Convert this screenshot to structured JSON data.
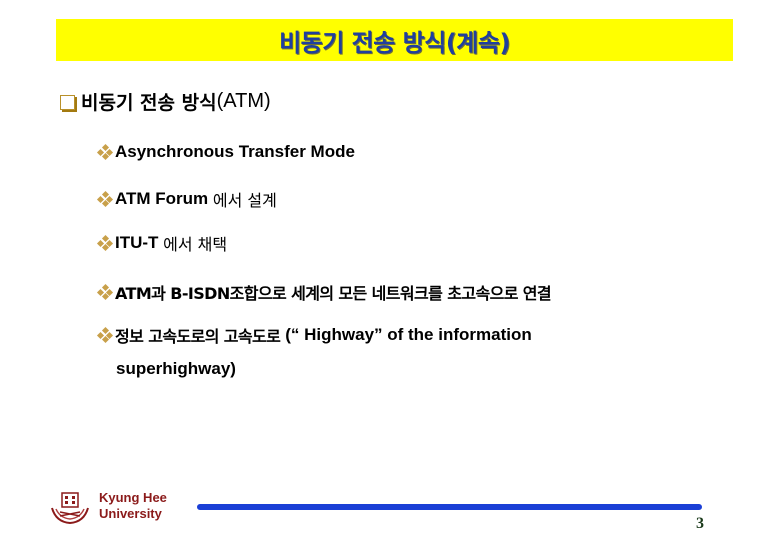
{
  "slide": {
    "title": "비동기 전송 방식(계속)",
    "heading": {
      "korean": "비동기 전송 방식",
      "english": "(ATM)",
      "bullet_icon": "hollow-square-bullet"
    },
    "bullets": [
      {
        "parts": [
          {
            "text": "Asynchronous Transfer Mode",
            "style": "en"
          }
        ]
      },
      {
        "parts": [
          {
            "text": "ATM Forum ",
            "style": "en"
          },
          {
            "text": "에서 설계",
            "style": "ko"
          }
        ]
      },
      {
        "parts": [
          {
            "text": "ITU-T ",
            "style": "en"
          },
          {
            "text": "에서 채택",
            "style": "ko"
          }
        ]
      },
      {
        "parts": [
          {
            "text": "ATM과 B-ISDN조합으로 세계의 모든 네트워크를 초고속으로 연결",
            "style": "kob"
          }
        ]
      },
      {
        "parts": [
          {
            "text": "정보 고속도로의 고속도로 ",
            "style": "kob"
          },
          {
            "text": "(“ Highway” of the information",
            "style": "en"
          }
        ]
      }
    ],
    "continuation": "superhighway)",
    "bullet_icon": "four-diamond-bullet"
  },
  "footer": {
    "university_line1": "Kyung Hee",
    "university_line2": "University",
    "logo_icon": "kyung-hee-crest",
    "page_number": "3"
  },
  "colors": {
    "title_bar": "#ffff00",
    "title_text": "#1f3f9f",
    "bullet": "#c8a04a",
    "footer_rule": "#1a3fd6",
    "university_text": "#8b1a1a"
  }
}
